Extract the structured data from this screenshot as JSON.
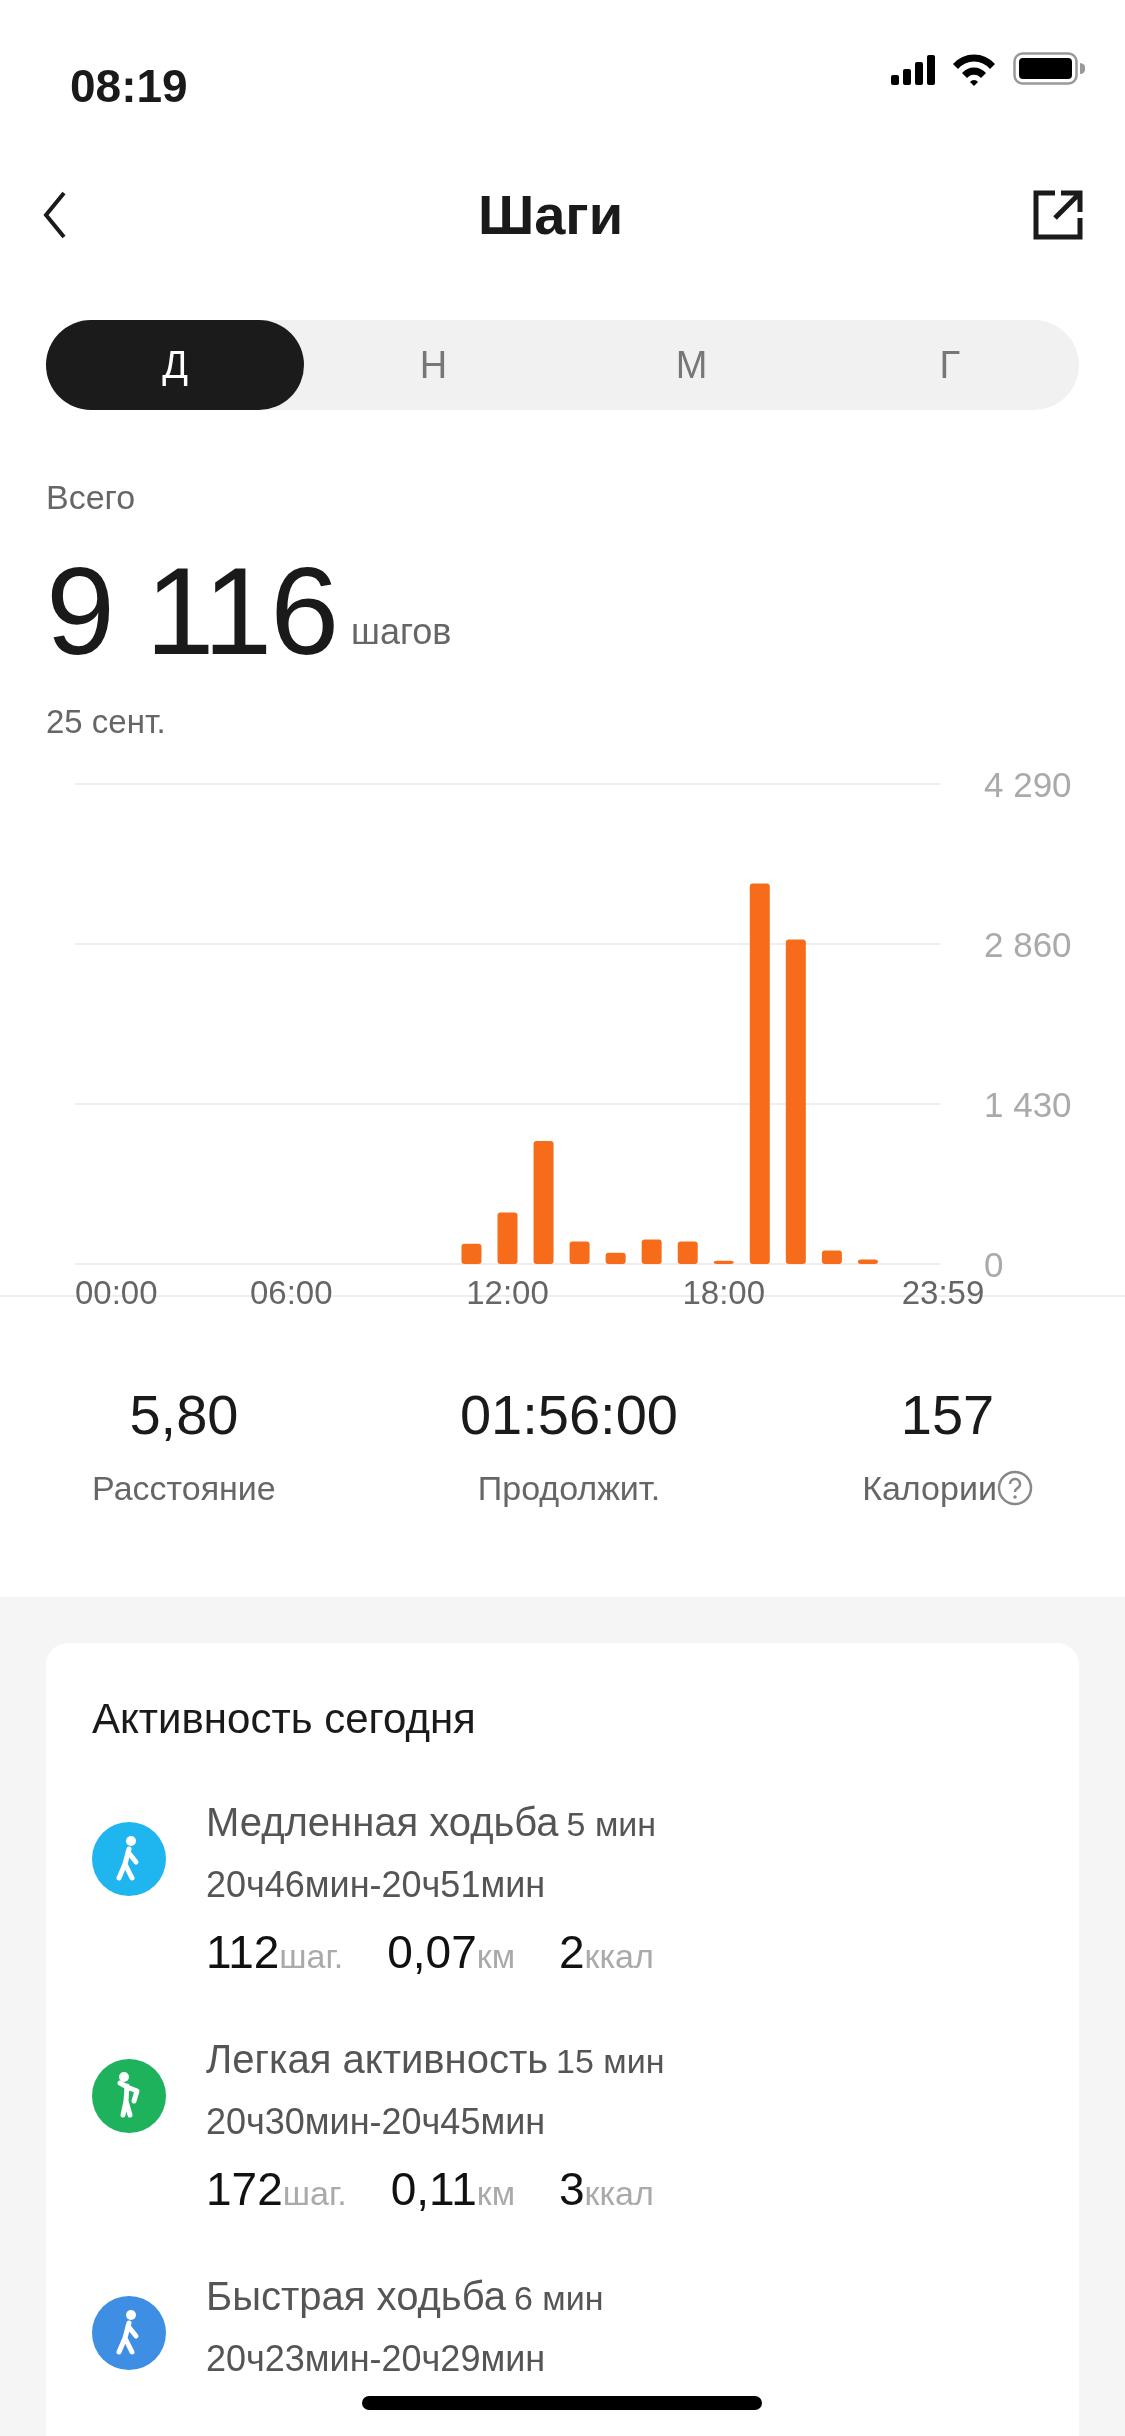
{
  "status_bar": {
    "time": "08:19"
  },
  "header": {
    "title": "Шаги"
  },
  "tabs": [
    {
      "label": "Д",
      "selected": true
    },
    {
      "label": "Н",
      "selected": false
    },
    {
      "label": "М",
      "selected": false
    },
    {
      "label": "Г",
      "selected": false
    }
  ],
  "summary": {
    "label": "Всего",
    "value": "9 116",
    "unit": "шагов",
    "date": "25 сент."
  },
  "chart_data": {
    "type": "bar",
    "x": [
      11,
      12,
      13,
      14,
      15,
      16,
      17,
      18,
      19,
      20,
      21,
      22
    ],
    "series": [
      {
        "color": "#f76c1b",
        "values": [
          180,
          460,
          1100,
          200,
          100,
          220,
          200,
          30,
          3400,
          2900,
          120,
          40
        ]
      }
    ],
    "xlim": [
      0,
      24
    ],
    "ylim": [
      0,
      4290
    ],
    "xticks": [
      {
        "value": 0,
        "label": "00:00"
      },
      {
        "value": 6,
        "label": "06:00"
      },
      {
        "value": 12,
        "label": "12:00"
      },
      {
        "value": 18,
        "label": "18:00"
      },
      {
        "value": 23.98,
        "label": "23:59"
      }
    ],
    "yticks": [
      {
        "value": 0,
        "label": "0"
      },
      {
        "value": 1430,
        "label": "1 430"
      },
      {
        "value": 2860,
        "label": "2 860"
      },
      {
        "value": 4290,
        "label": "4 290"
      }
    ]
  },
  "stats": [
    {
      "value": "5,80",
      "label": "Расстояние",
      "help": false
    },
    {
      "value": "01:56:00",
      "label": "Продолжит.",
      "help": false
    },
    {
      "value": "157",
      "label": "Калории",
      "help": true
    }
  ],
  "activity": {
    "title": "Активность сегодня",
    "items": [
      {
        "kind": "walk",
        "color": "#1fb6f0",
        "name": "Медленная ходьба",
        "duration": "5 мин",
        "time": "20ч46мин-20ч51мин",
        "metrics": [
          {
            "value": "112",
            "unit": "шаг."
          },
          {
            "value": "0,07",
            "unit": "км"
          },
          {
            "value": "2",
            "unit": "ккал"
          }
        ]
      },
      {
        "kind": "stand",
        "color": "#1db25b",
        "name": "Легкая активность",
        "duration": "15 мин",
        "time": "20ч30мин-20ч45мин",
        "metrics": [
          {
            "value": "172",
            "unit": "шаг."
          },
          {
            "value": "0,11",
            "unit": "км"
          },
          {
            "value": "3",
            "unit": "ккал"
          }
        ]
      },
      {
        "kind": "walk",
        "color": "#3e8ee4",
        "name": "Быстрая ходьба",
        "duration": "6 мин",
        "time": "20ч23мин-20ч29мин"
      }
    ]
  }
}
